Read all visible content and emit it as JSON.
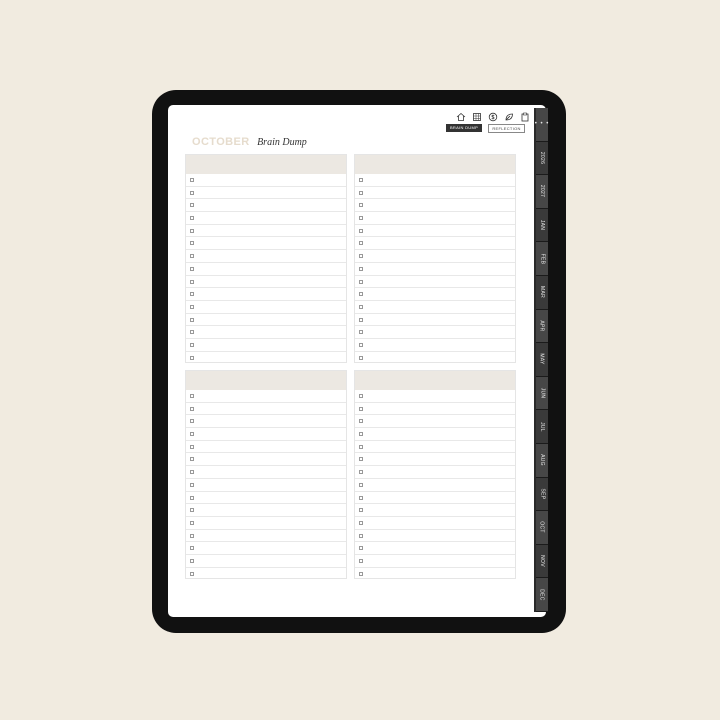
{
  "toolbar": {
    "icons": [
      "home-icon",
      "calendar-grid-icon",
      "dollar-icon",
      "leaf-icon",
      "clipboard-icon"
    ],
    "brain_dump_label": "BRAIN DUMP",
    "reflection_label": "REFLECTION"
  },
  "header": {
    "month": "OCTOBER",
    "subtitle": "Brain Dump"
  },
  "panels": {
    "count": 4,
    "rows_per_panel": 15
  },
  "side_tabs": {
    "more": "• • •",
    "items": [
      "2026",
      "2027",
      "JAN",
      "FEB",
      "MAR",
      "APR",
      "MAY",
      "JUN",
      "JUL",
      "AUG",
      "SEP",
      "OCT",
      "NOV",
      "DEC"
    ]
  },
  "colors": {
    "background": "#f1ebe0",
    "tablet_bezel": "#111111",
    "month_title": "#e6dccd",
    "panel_header": "#ece8e2",
    "tab_dark": "#3a3a3a"
  }
}
